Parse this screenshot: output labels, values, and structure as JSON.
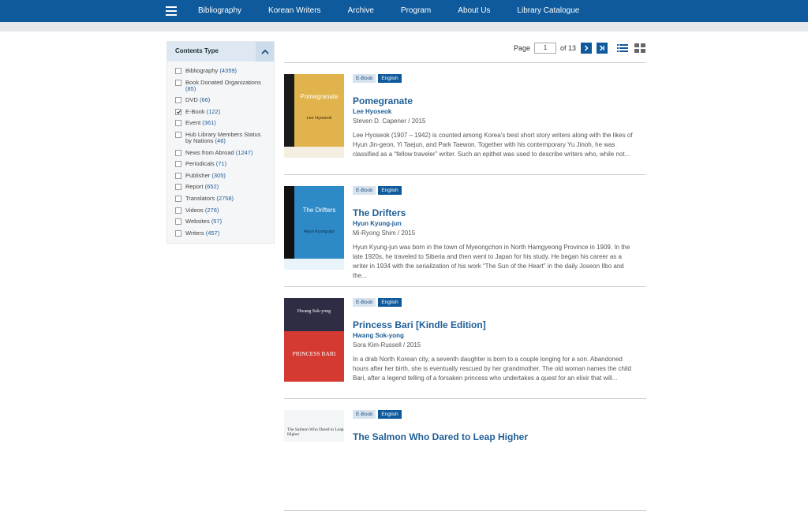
{
  "nav": {
    "items": [
      "Bibliography",
      "Korean Writers",
      "Archive",
      "Program",
      "About Us",
      "Library Catalogue"
    ]
  },
  "sidebar": {
    "title": "Contents Type",
    "filters": [
      {
        "label": "Bibliography",
        "count": "(4359)",
        "checked": false
      },
      {
        "label": "Book Donated Organizations",
        "count": "(85)",
        "checked": false
      },
      {
        "label": "DVD",
        "count": "(66)",
        "checked": false
      },
      {
        "label": "E-Book",
        "count": "(122)",
        "checked": true
      },
      {
        "label": "Event",
        "count": "(361)",
        "checked": false
      },
      {
        "label": "Hub Library Members Status by Nations",
        "count": "(46)",
        "checked": false
      },
      {
        "label": "News from Abroad",
        "count": "(1247)",
        "checked": false
      },
      {
        "label": "Periodicals",
        "count": "(71)",
        "checked": false
      },
      {
        "label": "Publisher",
        "count": "(305)",
        "checked": false
      },
      {
        "label": "Report",
        "count": "(652)",
        "checked": false
      },
      {
        "label": "Translators",
        "count": "(2758)",
        "checked": false
      },
      {
        "label": "Videos",
        "count": "(276)",
        "checked": false
      },
      {
        "label": "Websites",
        "count": "(57)",
        "checked": false
      },
      {
        "label": "Writers",
        "count": "(457)",
        "checked": false
      }
    ]
  },
  "pager": {
    "page_label": "Page",
    "current": "1",
    "of_label": "of 13"
  },
  "results": [
    {
      "tag_type": "E-Book",
      "tag_lang": "English",
      "title": "Pomegranate",
      "author": "Lee Hyoseok",
      "translator": "Steven D. Capener / 2015",
      "description": "Lee Hyoseok (1907 – 1942) is counted among Korea's best short story writers along with the likes of Hyun Jin-geon, Yi Taejun, and Park Taewon. Together with his contemporary Yu Jinoh, he was classified as a “fellow traveler” writer. Such an epithet was used to describe writers who, while not...",
      "cover": {
        "style": "yellow",
        "title": "Pomegranate",
        "author": "Lee Hyoseok"
      }
    },
    {
      "tag_type": "E-Book",
      "tag_lang": "English",
      "title": "The Drifters",
      "author": "Hyun Kyung-jun",
      "translator": "Mi-Ryong Shim / 2015",
      "description": "Hyun Kyung-jun was born in the town of Myeongchon in North Hamgyeong Province in 1909. In the late 1920s, he traveled to Siberia and then went to Japan for his study. He began his career as a writer in 1934 with the serialization of his work “The Sun of the Heart” in the daily Joseon Ilbo and the...",
      "cover": {
        "style": "blue",
        "title": "The Drifters",
        "author": "Hyun Kyung-jun"
      }
    },
    {
      "tag_type": "E-Book",
      "tag_lang": "English",
      "title": "Princess Bari [Kindle Edition]",
      "author": "Hwang Sok-yong",
      "translator": "Sora Kim-Russell / 2015",
      "description": "In a drab North Korean city, a seventh daughter is born to a couple longing for a son. Abandoned hours after her birth, she is eventually rescued by her grandmother. The old woman names the child Bari, after a legend telling of a forsaken princess who undertakes a quest for an elixir that will...",
      "cover": {
        "style": "red",
        "title": "PRINCESS BARI",
        "author": "Hwang Sok-yong"
      }
    },
    {
      "tag_type": "E-Book",
      "tag_lang": "English",
      "title": "The Salmon Who Dared to Leap Higher",
      "author": "",
      "translator": "",
      "description": "",
      "cover": {
        "style": "pale",
        "title": "The Salmon Who Dared to Leap Higher",
        "author": ""
      }
    }
  ]
}
